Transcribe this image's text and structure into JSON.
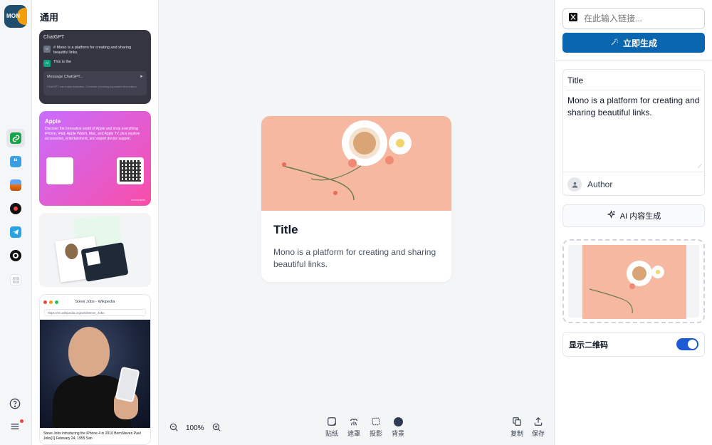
{
  "logo": {
    "text": "MON"
  },
  "gallery": {
    "title": "通用",
    "chatgpt": {
      "app_name": "ChatGPT",
      "user_badge": "U",
      "user_msg": "# Mono is a platform for creating and sharing beautiful links.",
      "ai_badge": "AI",
      "ai_msg": "This is the",
      "input_placeholder": "Message ChatGPT...",
      "disclaimer": "ChatGPT can make mistakes. Consider checking important information."
    },
    "apple": {
      "title": "Apple",
      "desc": "Discover the innovative world of Apple and shop everything iPhone, iPad, Apple Watch, Mac, and Apple TV, plus explore accessories, entertainment, and expert device support.",
      "footer": "monocards"
    },
    "wiki": {
      "title": "Steve Jobs - Wikipedia",
      "url": "https://en.wikipedia.org/wiki/Steve_Jobs",
      "caption": "Steve Jobs introducing the iPhone 4 in 2010 BornSteven Paul Jobs[1] February 24, 1955 San"
    }
  },
  "card": {
    "title": "Title",
    "desc": "Mono is a platform for creating and sharing beautiful links."
  },
  "toolbar": {
    "zoom": "100%",
    "paste": "贴纸",
    "mask": "遮罩",
    "shadow": "投影",
    "background": "背景",
    "copy": "复制",
    "save": "保存"
  },
  "panel": {
    "link_placeholder": "在此输入链接...",
    "generate": "立即生成",
    "form_title": "Title",
    "form_desc": "Mono is a platform for creating and sharing beautiful links.",
    "author": "Author",
    "ai_generate": "AI 内容生成",
    "show_qr": "显示二维码",
    "show_qr_on": true
  },
  "colors": {
    "accent": "#0b66b0",
    "toggle": "#1d5bd6",
    "card_bg": "#f6b8a0"
  }
}
